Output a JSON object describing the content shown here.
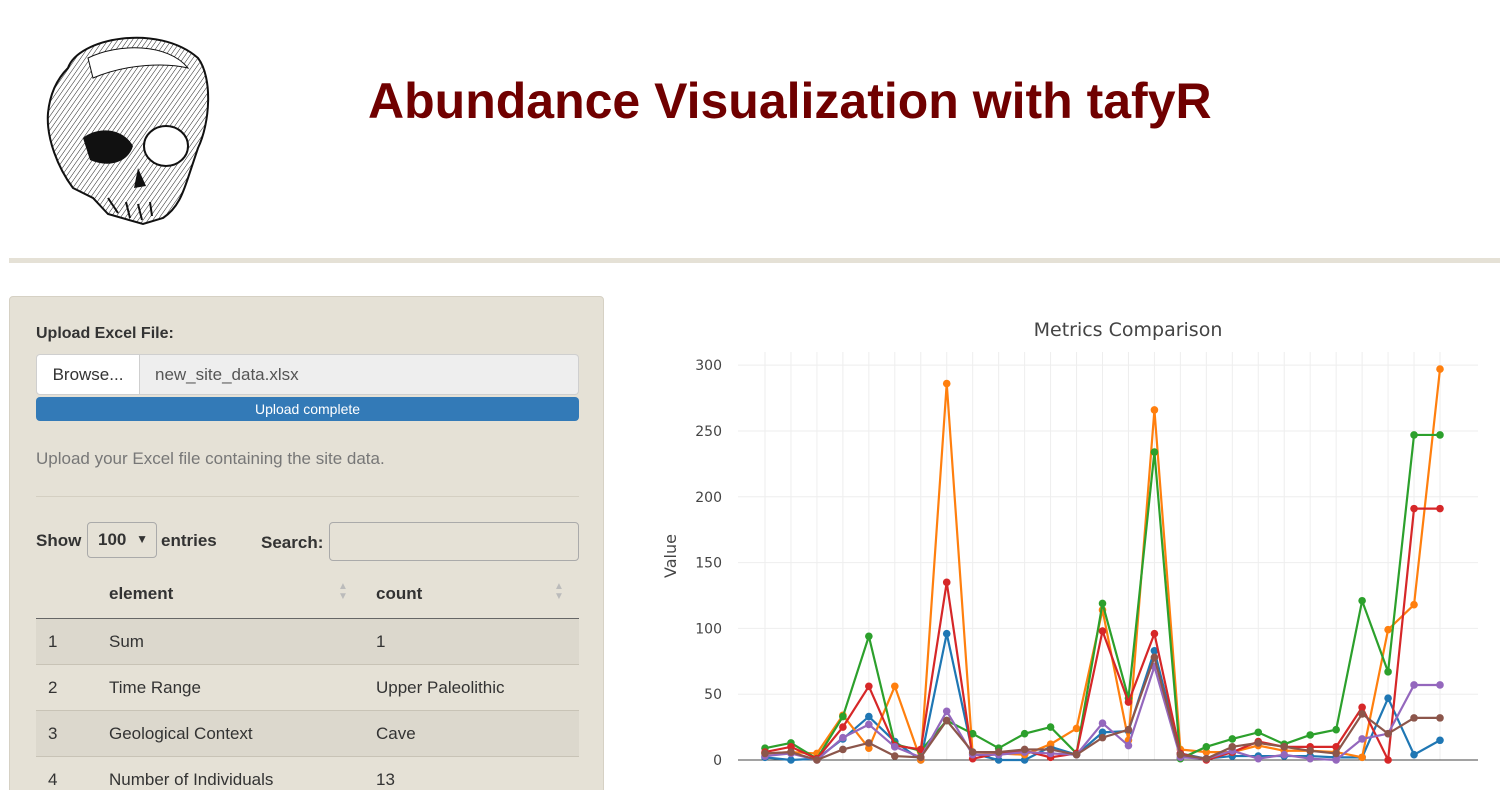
{
  "header": {
    "title": "Abundance Visualization with tafyR",
    "logo_icon": "skull-icon"
  },
  "sidebar": {
    "upload_label": "Upload Excel File:",
    "browse_label": "Browse...",
    "file_name": "new_site_data.xlsx",
    "progress_text": "Upload complete",
    "progress_fraction": 1.0,
    "help_text": "Upload your Excel file containing the site data.",
    "show_label": "Show",
    "length_value": "100",
    "entries_label": "entries",
    "search_label": "Search:",
    "search_value": ""
  },
  "table": {
    "columns": [
      "",
      "element",
      "count"
    ],
    "rows": [
      [
        "1",
        "Sum",
        "1"
      ],
      [
        "2",
        "Time Range",
        "Upper Paleolithic"
      ],
      [
        "3",
        "Geological Context",
        "Cave"
      ],
      [
        "4",
        "Number of Individuals",
        "13"
      ]
    ]
  },
  "colors": {
    "title": "#700000",
    "panel": "#e5e1d6",
    "progress": "#337ab7"
  },
  "chart_data": {
    "type": "line",
    "title": "Metrics Comparison",
    "xlabel": "",
    "ylabel": "Value",
    "ylim": [
      0,
      310
    ],
    "yticks": [
      0,
      50,
      100,
      150,
      200,
      250,
      300
    ],
    "grid": true,
    "x": [
      1,
      2,
      3,
      4,
      5,
      6,
      7,
      8,
      9,
      10,
      11,
      12,
      13,
      14,
      15,
      16,
      17,
      18,
      19,
      20,
      21,
      22,
      23,
      24,
      25,
      26,
      27
    ],
    "series": [
      {
        "color": "#1f77b4",
        "values": [
          2,
          0,
          1,
          16,
          33,
          14,
          0,
          96,
          5,
          0,
          0,
          10,
          4,
          21,
          22,
          83,
          5,
          1,
          3,
          3,
          3,
          3,
          2,
          2,
          47,
          4,
          15
        ]
      },
      {
        "color": "#ff7f0e",
        "values": [
          5,
          6,
          5,
          34,
          9,
          56,
          0,
          286,
          4,
          5,
          4,
          12,
          24,
          114,
          15,
          266,
          8,
          6,
          6,
          11,
          7,
          7,
          6,
          2,
          99,
          118,
          297
        ]
      },
      {
        "color": "#2ca02c",
        "values": [
          9,
          13,
          1,
          33,
          94,
          12,
          7,
          30,
          20,
          9,
          20,
          25,
          5,
          119,
          47,
          234,
          1,
          10,
          16,
          21,
          12,
          19,
          23,
          121,
          67,
          247,
          247
        ]
      },
      {
        "color": "#d62728",
        "values": [
          6,
          10,
          1,
          25,
          56,
          11,
          8,
          135,
          1,
          5,
          7,
          2,
          5,
          98,
          44,
          96,
          5,
          0,
          6,
          14,
          10,
          10,
          10,
          40,
          0,
          191,
          191
        ]
      },
      {
        "color": "#9467bd",
        "values": [
          3,
          5,
          0,
          17,
          27,
          10,
          2,
          37,
          4,
          4,
          6,
          5,
          4,
          28,
          11,
          71,
          2,
          1,
          7,
          1,
          4,
          1,
          0,
          16,
          20,
          57,
          57
        ]
      },
      {
        "color": "#8c564b",
        "values": [
          5,
          6,
          0,
          8,
          13,
          3,
          2,
          30,
          6,
          6,
          8,
          8,
          4,
          17,
          23,
          78,
          4,
          1,
          10,
          13,
          10,
          7,
          5,
          35,
          20,
          32,
          32
        ]
      }
    ]
  }
}
